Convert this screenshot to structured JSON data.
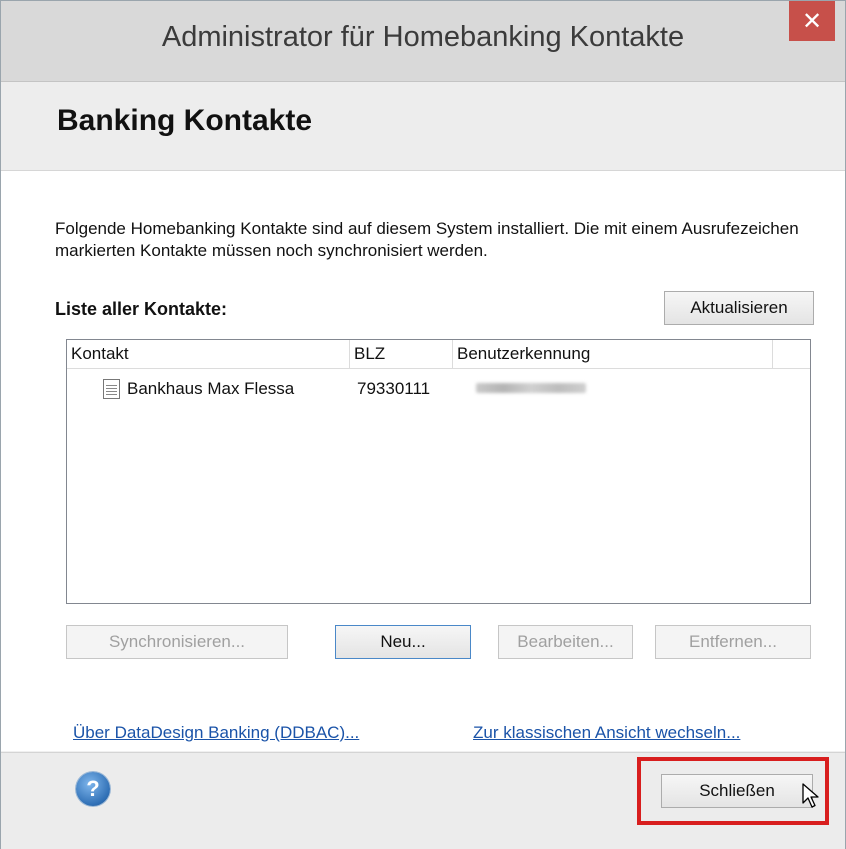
{
  "window": {
    "title": "Administrator für Homebanking Kontakte",
    "close_glyph": "✕"
  },
  "header": {
    "title": "Banking Kontakte"
  },
  "content": {
    "intro": "Folgende Homebanking Kontakte sind auf diesem System installiert. Die mit einem Ausrufezeichen markierten Kontakte müssen noch synchronisiert werden.",
    "list_label": "Liste aller Kontakte:",
    "refresh_button": "Aktualisieren",
    "columns": [
      "Kontakt",
      "BLZ",
      "Benutzerkennung"
    ],
    "rows": [
      {
        "kontakt": "Bankhaus Max Flessa",
        "blz": "79330111",
        "icon": "document-icon"
      }
    ],
    "buttons": {
      "sync": "Synchronisieren...",
      "new": "Neu...",
      "edit": "Bearbeiten...",
      "remove": "Entfernen..."
    },
    "links": {
      "about": "Über DataDesign Banking (DDBAC)...",
      "classic_view": "Zur klassischen Ansicht wechseln..."
    }
  },
  "footer": {
    "help_glyph": "?",
    "close_button": "Schließen"
  },
  "colors": {
    "close_button_bg": "#c7504a",
    "highlight": "#d81e1e",
    "link": "#1a53a8"
  }
}
